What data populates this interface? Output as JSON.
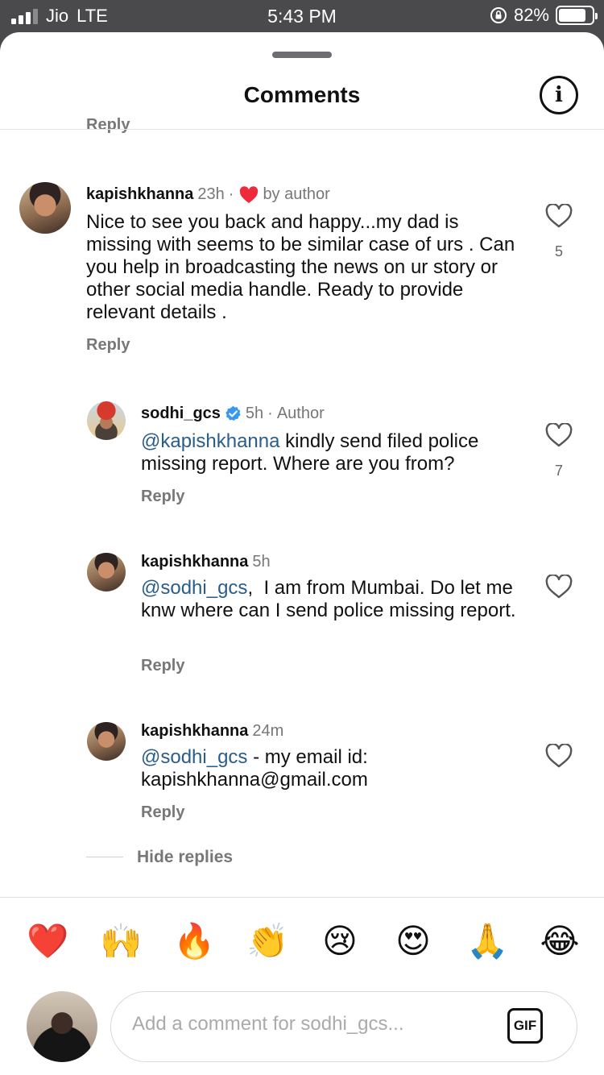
{
  "status_bar": {
    "carrier": "Jio",
    "network": "LTE",
    "time": "5:43 PM",
    "battery": "82%",
    "battery_level": 0.82
  },
  "sheet": {
    "title": "Comments",
    "info_icon": "i"
  },
  "partial_reply_label": "Reply",
  "comments": [
    {
      "username": "kapishkhanna",
      "time": "23h",
      "separator": "·",
      "liked_by": "by author",
      "text": "Nice to see you back and happy...my dad is missing with seems to be similar case of urs . Can you help in broadcasting the news on ur story or other social media handle. Ready to provide relevant details .",
      "likes": "5",
      "reply_label": "Reply"
    },
    {
      "username": "sodhi_gcs",
      "time": "5h",
      "separator": "·",
      "badge": "Author",
      "mention": "@kapishkhanna",
      "text": " kindly send filed police missing report. Where are you from?",
      "likes": "7",
      "reply_label": "Reply"
    },
    {
      "username": "kapishkhanna",
      "time": "5h",
      "mention": "@sodhi_gcs",
      "text": ",  I am from Mumbai. Do let me knw where can I send police missing report.",
      "reply_label": "Reply"
    },
    {
      "username": "kapishkhanna",
      "time": "24m",
      "mention": "@sodhi_gcs",
      "text": " - my email id: kapishkhanna@gmail.com",
      "reply_label": "Reply"
    }
  ],
  "hide_replies": "Hide replies",
  "emojis": [
    "❤️",
    "🙌",
    "🔥",
    "👏",
    "😢",
    "😍",
    "🙏",
    "😂"
  ],
  "composer": {
    "placeholder": "Add a comment for sodhi_gcs...",
    "gif_label": "GIF"
  },
  "colors": {
    "mention": "#2a5d8c",
    "heart_red": "#ed2b3b",
    "verified_blue": "#3897f0"
  }
}
